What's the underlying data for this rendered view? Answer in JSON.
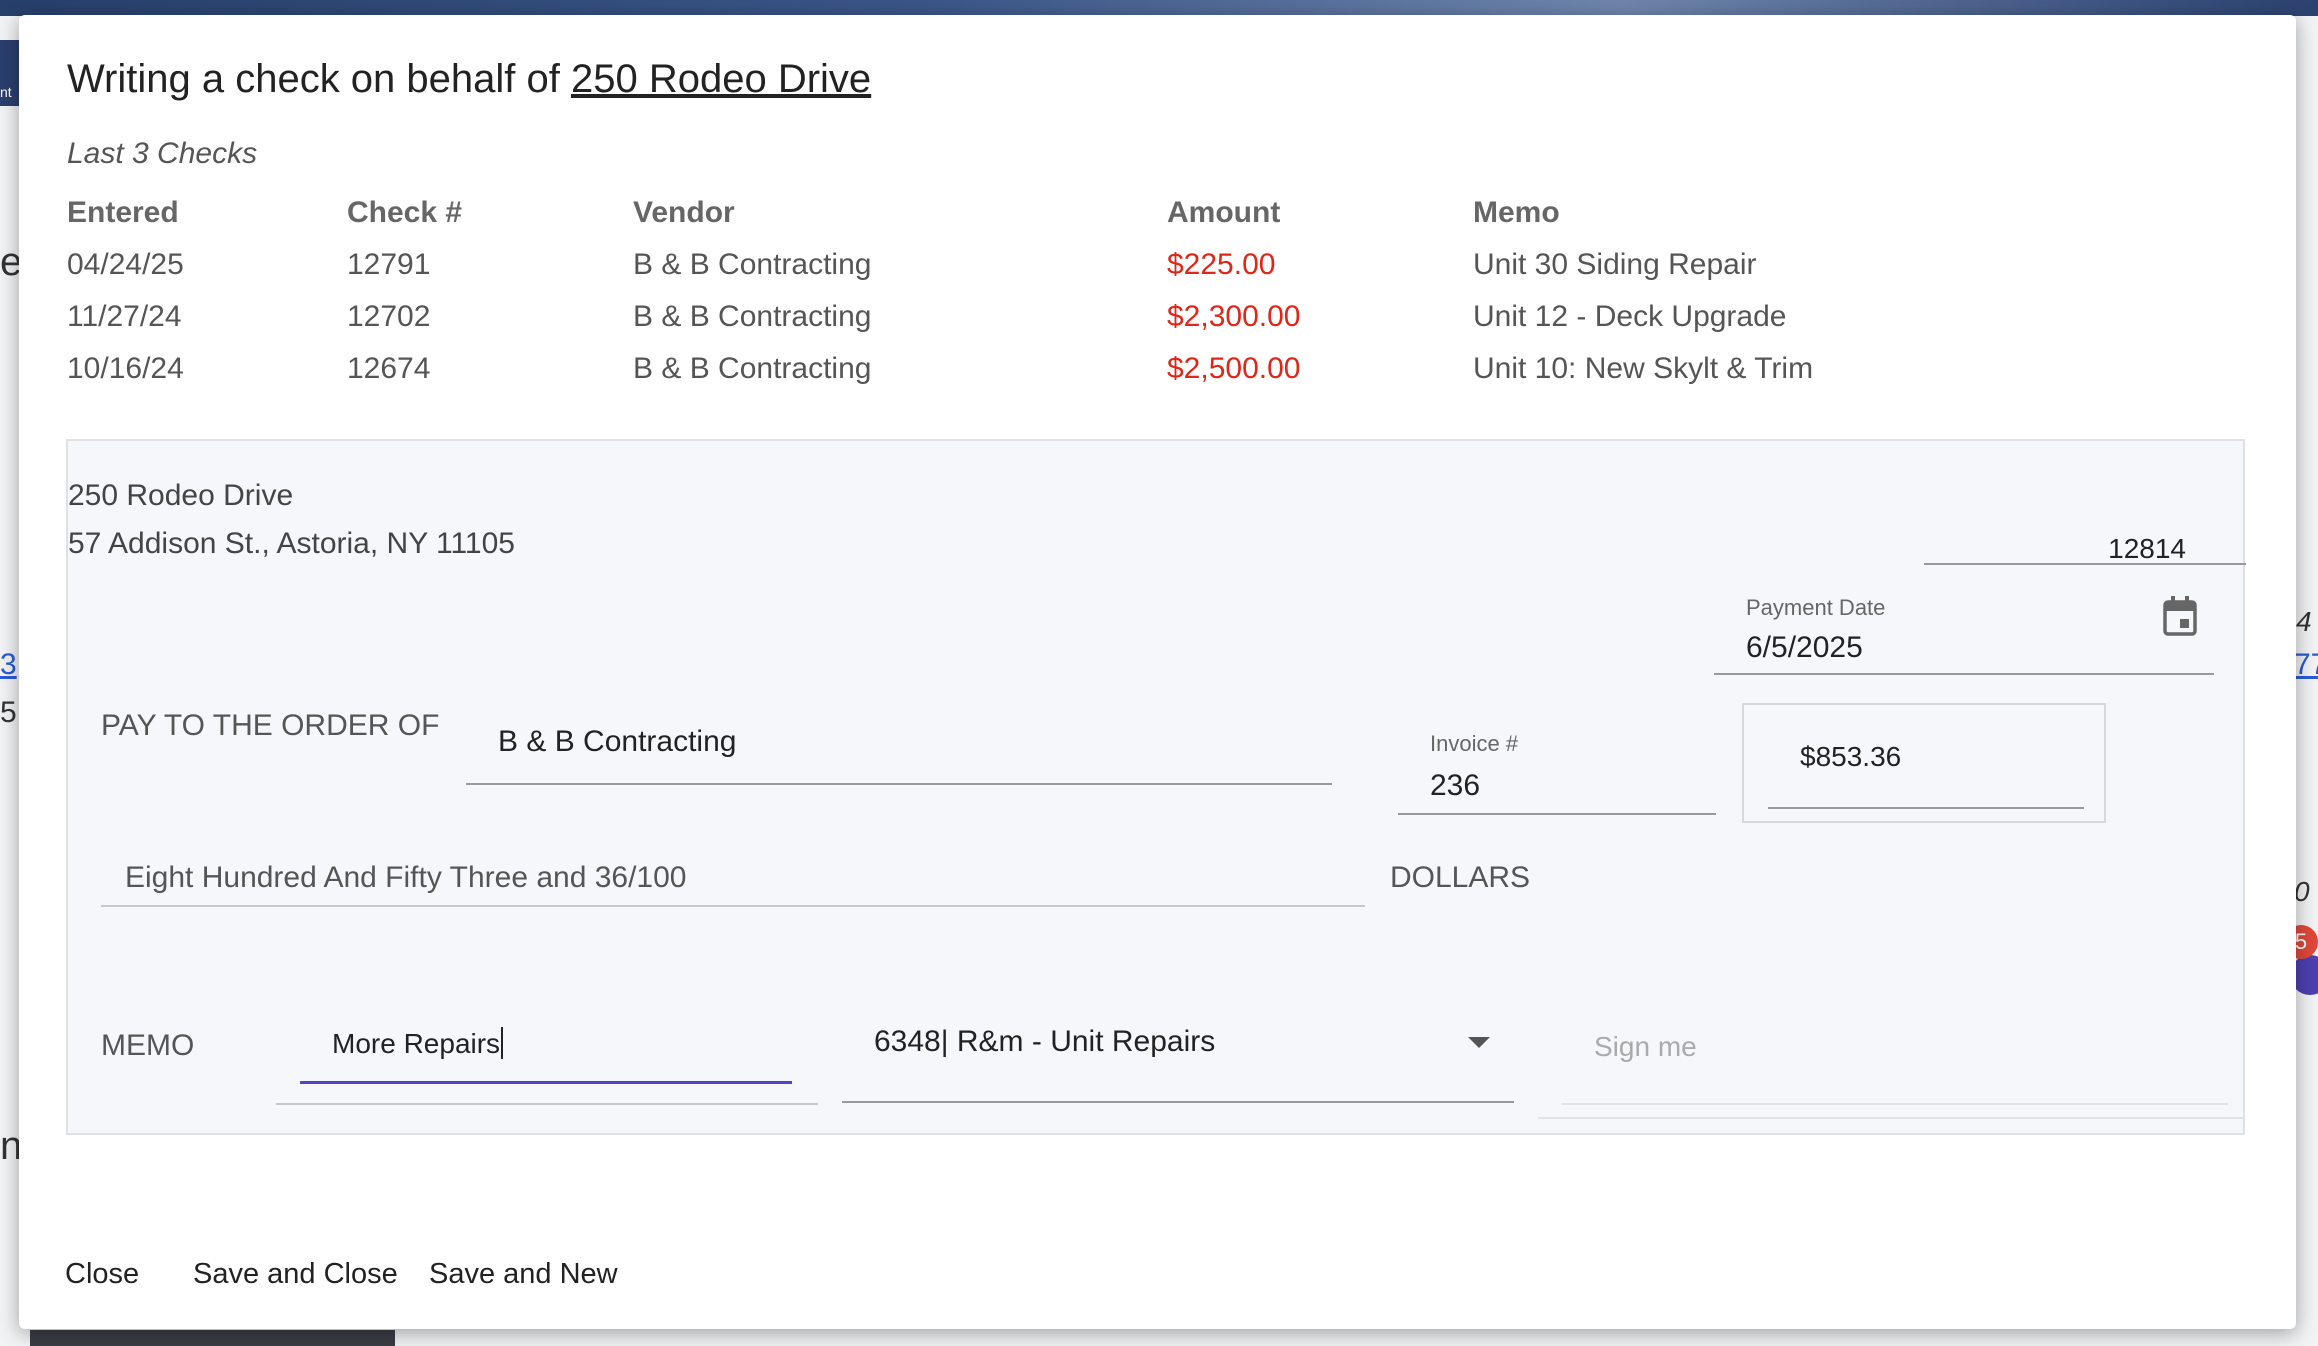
{
  "background": {
    "left_fragments": [
      "nt",
      "e",
      "3",
      "5",
      "n"
    ],
    "right_fragments": [
      "4",
      "77",
      "0"
    ],
    "badge_count": "5"
  },
  "modal": {
    "title_prefix": "Writing a check on behalf of",
    "title_property": "250 Rodeo Drive"
  },
  "recent_checks": {
    "caption": "Last 3 Checks",
    "headers": [
      "Entered",
      "Check #",
      "Vendor",
      "Amount",
      "Memo"
    ],
    "rows": [
      {
        "entered": "04/24/25",
        "check_no": "12791",
        "vendor": "B & B Contracting",
        "amount": "$225.00",
        "memo": "Unit 30 Siding Repair"
      },
      {
        "entered": "11/27/24",
        "check_no": "12702",
        "vendor": "B & B Contracting",
        "amount": "$2,300.00",
        "memo": "Unit 12 - Deck Upgrade"
      },
      {
        "entered": "10/16/24",
        "check_no": "12674",
        "vendor": "B & B Contracting",
        "amount": "$2,500.00",
        "memo": "Unit 10: New Skylt & Trim"
      }
    ]
  },
  "check": {
    "property_name": "250 Rodeo Drive",
    "property_address": "57 Addison St., Astoria, NY 11105",
    "check_number": "12814",
    "payment_date_label": "Payment Date",
    "payment_date": "6/5/2025",
    "pay_to_label": "PAY TO THE ORDER OF",
    "payee": "B & B Contracting",
    "invoice_label": "Invoice #",
    "invoice_number": "236",
    "amount": "$853.36",
    "amount_words": "Eight Hundred And Fifty Three and 36/100",
    "dollars_label": "DOLLARS",
    "memo_label": "MEMO",
    "memo_value": "More Repairs",
    "account": "6348| R&m - Unit Repairs",
    "signature_placeholder": "Sign me"
  },
  "footer": {
    "close_label": "Close",
    "save_close_label": "Save and Close",
    "save_new_label": "Save and New"
  },
  "colors": {
    "negative_amount": "#e02618",
    "focus_accent": "#5b3fc4"
  },
  "icons": {
    "calendar": "calendar-icon",
    "dropdown": "chevron-down-icon"
  }
}
